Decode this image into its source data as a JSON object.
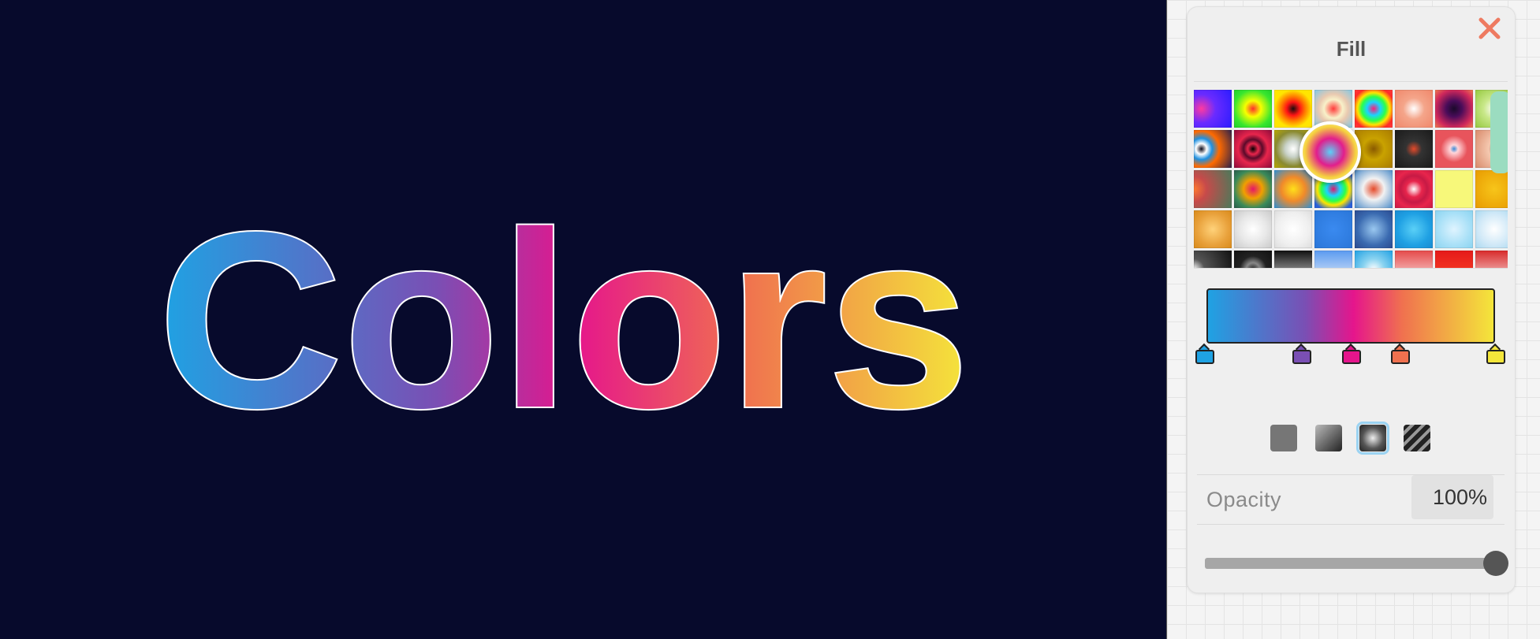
{
  "canvas": {
    "background": "#070a2c",
    "text": "Colors",
    "gradient": [
      "#1fa2e3",
      "#7a4fb4",
      "#e5158c",
      "#f0714f",
      "#f4e63a"
    ],
    "stroke": "#ffffff"
  },
  "panel": {
    "title": "Fill",
    "close_icon": "close-icon",
    "opacity_label": "Opacity",
    "opacity_value": "100%",
    "opacity_fraction": 1.0,
    "fill_types": [
      "solid",
      "linear-gradient",
      "radial-gradient",
      "pattern"
    ],
    "selected_fill_type": "radial-gradient",
    "gradient_stops": [
      "#1fa2e3",
      "#7a4fb4",
      "#e5158c",
      "#f0714f",
      "#f4e63a"
    ],
    "swatches": [
      "radial-gradient(circle at 20% 50%, #ff3aa0 0%, #6a2bff 40%, #2a1cff 100%)",
      "radial-gradient(circle, #ff2d2d 0%, #f7ff00 30%, #38e62f 70%, #1fcf2a 100%)",
      "radial-gradient(circle, #1a0d0d 0%, #ff1515 25%, #ff7a00 45%, #ffe500 70%, #ffe500 100%)",
      "radial-gradient(circle, #ff3b3b 0%, #f8f1c9 35%, #e9c9b0 55%, #7fc7e6 100%)",
      "radial-gradient(circle, #ff1a7a 0%, #1ad3ff 25%, #2bff4a 45%, #ffe400 60%, #ff2a2a 80%, #ff3d3d 100%)",
      "radial-gradient(circle, #ffffff 0%, #f4a58a 40%, #f0876a 100%)",
      "radial-gradient(circle, #1a0a2a 0%, #4a0c5a 30%, #d0285b 70%, #ef7c4f 100%)",
      "radial-gradient(circle, #ffffff 0%, #c9e88a 40%, #94c83d 100%)",
      "radial-gradient(circle at 20% 50%, #0a0a1a 0%, #ffffff 15%, #1e90e0 30%, #ff6a00 50%, #2a1f4a 100%)",
      "radial-gradient(circle, #000 0%, #e8254c 20%, #5a0a2a 35%, #e8254c 55%, #8a0a3a 100%)",
      "radial-gradient(circle, #ffffff 0%, #c9d2c9 30%, #8a8a30 65%, #b8a800 100%)",
      "radial-gradient(circle, #ffffff 0%, #ffffff 100%)",
      "radial-gradient(circle, #8a5a00 0%, #c9a200 40%, #a87a00 100%)",
      "radial-gradient(circle, #e54a2a 0%, #333 30%, #1a1a1a 100%)",
      "radial-gradient(circle, #3a8ad8 0%, #ffd6da 15%, #e8545c 50%, #e8545c 100%)",
      "radial-gradient(circle at 70% 50%, #000 0%, #f5c9b0 40%, #d8896a 100%)",
      "radial-gradient(circle at 0% 50%, #ff7a30 0%, #c74a4a 30%, #4a7a5a 100%)",
      "radial-gradient(circle, #e5156a 0%, #f0a000 35%, #3a8a5a 70%, #2a5a4a 100%)",
      "radial-gradient(circle, #ffe01a 0%, #f08a2a 45%, #2a90d8 100%)",
      "radial-gradient(circle, #e5156a 0%, #1ad3ff 25%, #2bff4a 45%, #ffe400 60%, #2a60d8 85%, #2a60d8 100%)",
      "radial-gradient(circle, #e54a2a 0%, #f2f2f2 40%, #4a8ac8 100%)",
      "radial-gradient(circle, #ffffff 0%, #e8254c 30%, #c71a45 50%, #e8254c 70%, #c71a45 100%)",
      "radial-gradient(circle, #f7f87a 0%, #f7f87a 100%)",
      "radial-gradient(circle, #f7c51a 0%, #e89a00 100%)",
      "radial-gradient(circle, #ffd27a 0%, #e8a03a 60%, #d88a1a 100%)",
      "radial-gradient(circle, #ffffff 0%, #e8e8e8 50%, #c9c9c9 100%)",
      "radial-gradient(circle, #ffffff 0%, #efefef 60%, #dcdcdc 100%)",
      "radial-gradient(circle, #3a8af0 0%, #2a76d8 100%)",
      "radial-gradient(circle, #9ac8f0 0%, #3a6ab0 60%, #2a4a90 100%)",
      "radial-gradient(circle, #5ad0f7 0%, #1fa0e3 60%, #1a8ad0 100%)",
      "radial-gradient(circle, #dff4ff 0%, #a8e0f7 60%, #8ad3f0 100%)",
      "radial-gradient(circle, #ffffff 0%, #cfe8f7 60%, #a8d8f0 100%)",
      "radial-gradient(circle at 0% 50%, #ffffff 0%, #555 25%, #111 100%)",
      "radial-gradient(circle, #222 0%, #888 25%, #222 50%, #111 100%)",
      "linear-gradient(180deg, #111 0%, #aaa 70%, #fff 100%)",
      "linear-gradient(180deg, #5a9af0 0%, #cfe0f7 70%, #ffffff 100%)",
      "radial-gradient(circle, #ffffff 0%, #8ad3f0 40%, #1fa0e3 100%)",
      "linear-gradient(180deg, #e54a4a 0%, #ffffff 100%)",
      "linear-gradient(180deg, #e51a1a 0%, #ff4a2a 100%)",
      "linear-gradient(180deg, #d82a2a 0%, #ffffff 100%)"
    ]
  }
}
